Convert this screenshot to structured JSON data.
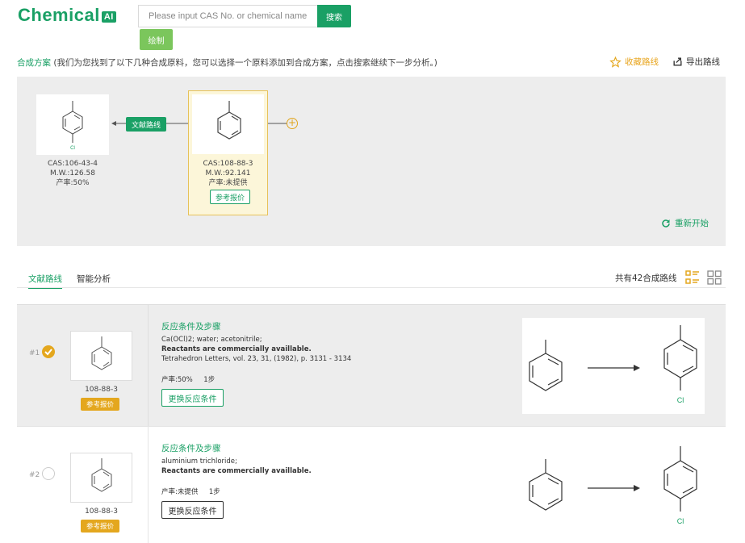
{
  "header": {
    "logo": "Chemical",
    "logo_badge": "AI",
    "search_placeholder": "Please input CAS No. or chemical name",
    "search_button": "搜索",
    "draw_button": "绘制"
  },
  "plan": {
    "title": "合成方案",
    "description": "(我们为您找到了以下几种合成原料，您可以选择一个原料添加到合成方案，点击搜索继续下一步分析。)",
    "favorite": "收藏路线",
    "export": "导出路线"
  },
  "canvas": {
    "target": {
      "cas": "CAS:106-43-4",
      "mw": "M.W.:126.58",
      "yield": "产率:50%"
    },
    "route_tag": "文献路线",
    "selected": {
      "cas": "CAS:108-88-3",
      "mw": "M.W.:92.141",
      "yield": "产率:未提供",
      "quote": "参考报价"
    },
    "plus": "+",
    "restart": "重新开始"
  },
  "tabs": {
    "literature": "文献路线",
    "ai": "智能分析",
    "total": "共有42合成路线"
  },
  "routes": [
    {
      "num": "#1",
      "cas": "108-88-3",
      "quote": "参考报价",
      "cond_title": "反应条件及步骤",
      "line1": "Ca(OCl)2; water; acetonitrile;",
      "line2": "Reactants are commercially availlable.",
      "line3": "Tetrahedron Letters, vol. 23, 31, (1982), p. 3131 - 3134",
      "yield": "产率:50%",
      "steps": "1步",
      "change": "更换反应条件",
      "product_label": "Cl"
    },
    {
      "num": "#2",
      "cas": "108-88-3",
      "quote": "参考报价",
      "cond_title": "反应条件及步骤",
      "line1": "aluminium trichloride;",
      "line2": "Reactants are commercially availlable.",
      "yield": "产率:未提供",
      "steps": "1步",
      "change": "更换反应条件",
      "product_label": "Cl"
    }
  ],
  "colors": {
    "green": "#1aa065",
    "yellow": "#e4a71e",
    "grey_bg": "#ededed"
  }
}
